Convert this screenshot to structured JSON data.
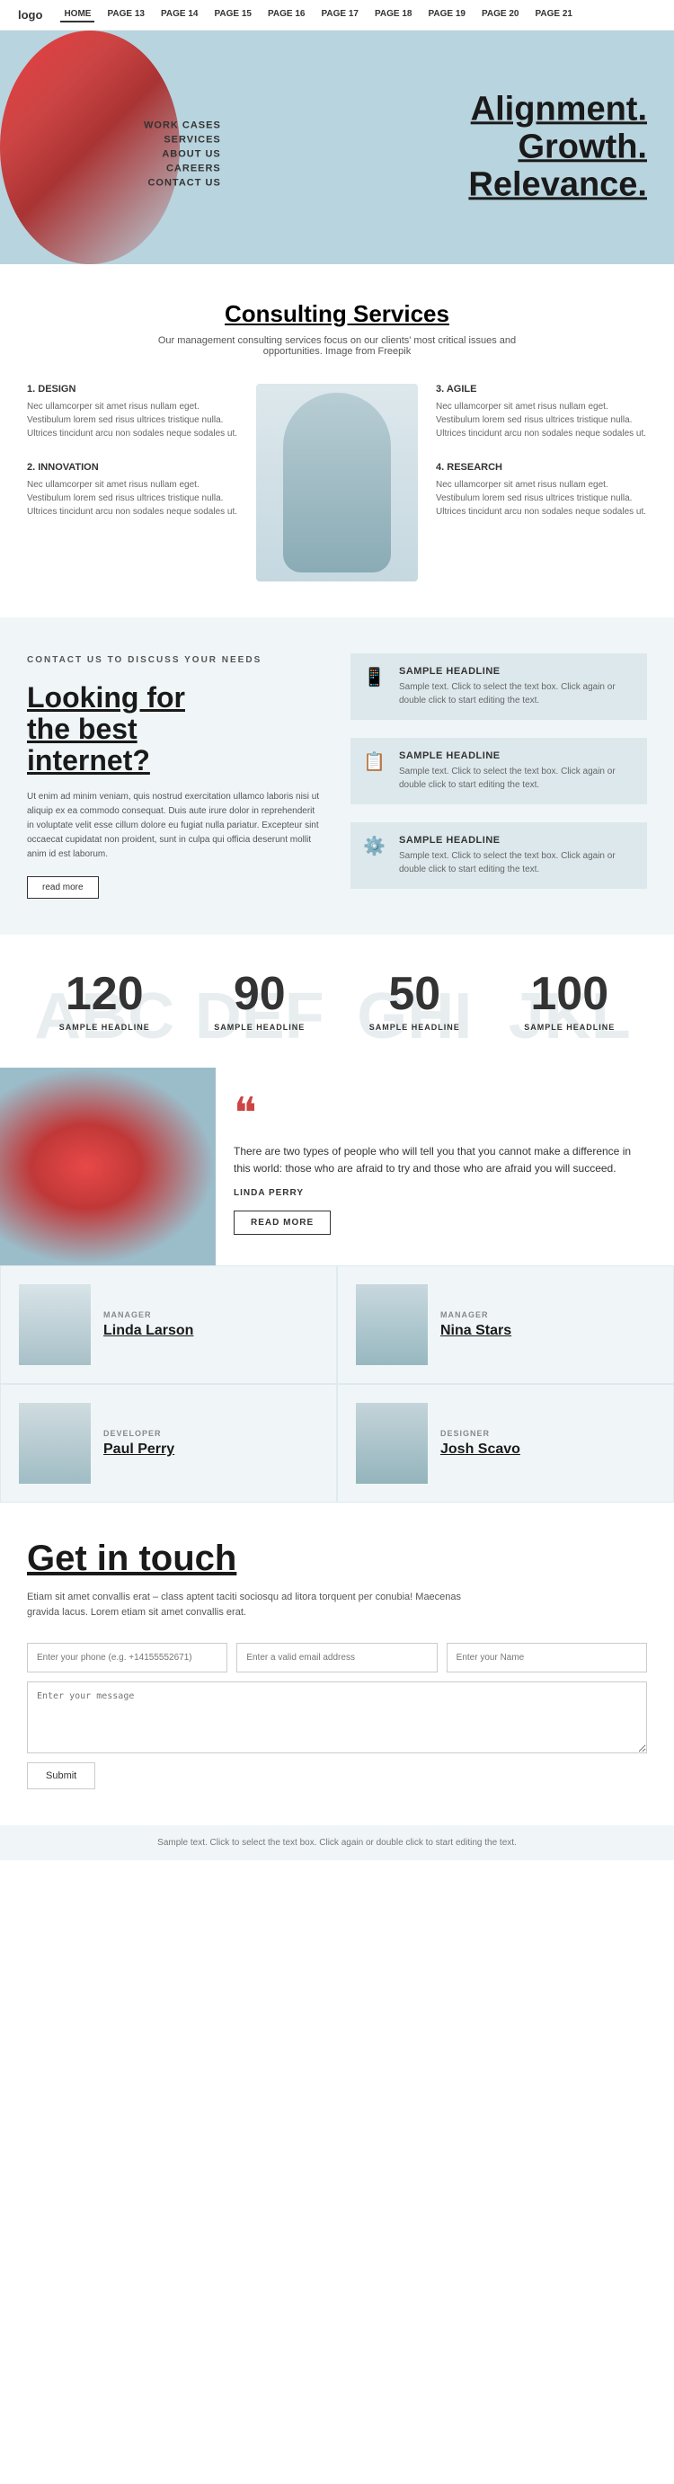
{
  "nav": {
    "logo": "logo",
    "links": [
      {
        "label": "HOME",
        "active": true
      },
      {
        "label": "PAGE 13"
      },
      {
        "label": "PAGE 14"
      },
      {
        "label": "PAGE 15"
      },
      {
        "label": "PAGE 16"
      },
      {
        "label": "PAGE 17"
      },
      {
        "label": "PAGE 18"
      },
      {
        "label": "PAGE 19"
      },
      {
        "label": "PAGE 20"
      },
      {
        "label": "PAGE 21"
      }
    ]
  },
  "hero": {
    "menu": [
      {
        "label": "WORK CASES"
      },
      {
        "label": "SERVICES"
      },
      {
        "label": "ABOUT US"
      },
      {
        "label": "CAREERS"
      },
      {
        "label": "CONTACT US"
      }
    ],
    "tagline_line1": "Alignment.",
    "tagline_line2": "Growth.",
    "tagline_line3": "Relevance."
  },
  "consulting": {
    "title": "Consulting Services",
    "subtitle": "Our management consulting services focus on our clients' most critical issues and opportunities.  Image from Freepik",
    "items_left": [
      {
        "number": "1.",
        "title": "DESIGN",
        "text": "Nec ullamcorper sit amet risus nullam eget. Vestibulum lorem sed risus ultrices tristique nulla. Ultrices tincidunt arcu non sodales neque sodales ut."
      },
      {
        "number": "2.",
        "title": "INNOVATION",
        "text": "Nec ullamcorper sit amet risus nullam eget. Vestibulum lorem sed risus ultrices tristique nulla. Ultrices tincidunt arcu non sodales neque sodales ut."
      }
    ],
    "items_right": [
      {
        "number": "3.",
        "title": "AGILE",
        "text": "Nec ullamcorper sit amet risus nullam eget. Vestibulum lorem sed risus ultrices tristique nulla. Ultrices tincidunt arcu non sodales neque sodales ut."
      },
      {
        "number": "4.",
        "title": "RESEARCH",
        "text": "Nec ullamcorper sit amet risus nullam eget. Vestibulum lorem sed risus ultrices tristique nulla. Ultrices tincidunt arcu non sodales neque sodales ut."
      }
    ]
  },
  "internet": {
    "contact_label": "CONTACT US TO DISCUSS YOUR NEEDS",
    "heading_line1": "Looking for",
    "heading_line2": "the best",
    "heading_line3": "internet?",
    "body_text": "Ut enim ad minim veniam, quis nostrud exercitation ullamco laboris nisi ut aliquip ex ea commodo consequat. Duis aute irure dolor in reprehenderit in voluptate velit esse cillum dolore eu fugiat nulla pariatur. Excepteur sint occaecat cupidatat non proident, sunt in culpa qui officia deserunt mollit anim id est laborum.",
    "read_more": "read more",
    "headlines": [
      {
        "icon": "📱",
        "title": "SAMPLE HEADLINE",
        "text": "Sample text. Click to select the text box. Click again or double click to start editing the text."
      },
      {
        "icon": "📋",
        "title": "SAMPLE HEADLINE",
        "text": "Sample text. Click to select the text box. Click again or double click to start editing the text."
      },
      {
        "icon": "⚙️",
        "title": "SAMPLE HEADLINE",
        "text": "Sample text. Click to select the text box. Click again or double click to start editing the text."
      }
    ]
  },
  "stats": [
    {
      "number": "120",
      "bg": "ABC",
      "label": "SAMPLE HEADLINE"
    },
    {
      "number": "90",
      "bg": "DEF",
      "label": "SAMPLE HEADLINE"
    },
    {
      "number": "50",
      "bg": "GHI",
      "label": "SAMPLE HEADLINE"
    },
    {
      "number": "100",
      "bg": "JKL",
      "label": "SAMPLE HEADLINE"
    }
  ],
  "quote": {
    "mark": "❝",
    "text": "There are two types of people who will tell you that you cannot make a difference in this world: those who are afraid to try and those who are afraid you will succeed.",
    "author": "LINDA PERRY",
    "read_more": "READ MORE"
  },
  "team": {
    "members": [
      {
        "role": "MANAGER",
        "name": "Linda Larson",
        "photo_class": "photo-manager1"
      },
      {
        "role": "MANAGER",
        "name": "Nina Stars",
        "photo_class": "photo-manager2"
      },
      {
        "role": "DEVELOPER",
        "name": "Paul Perry",
        "photo_class": "photo-dev"
      },
      {
        "role": "DESIGNER",
        "name": "Josh Scavo",
        "photo_class": "photo-designer"
      }
    ]
  },
  "contact": {
    "title": "Get in touch",
    "subtitle": "Etiam sit amet convallis erat – class aptent taciti sociosqu ad litora torquent per conubia! Maecenas gravida lacus. Lorem etiam sit amet convallis erat.",
    "form": {
      "phone_placeholder": "Enter your phone (e.g. +14155552671)",
      "email_placeholder": "Enter a valid email address",
      "name_placeholder": "Enter your Name",
      "message_placeholder": "Enter your message",
      "submit_label": "Submit"
    }
  },
  "footer": {
    "text": "Sample text. Click to select the text box. Click again or double click to start editing the text."
  }
}
